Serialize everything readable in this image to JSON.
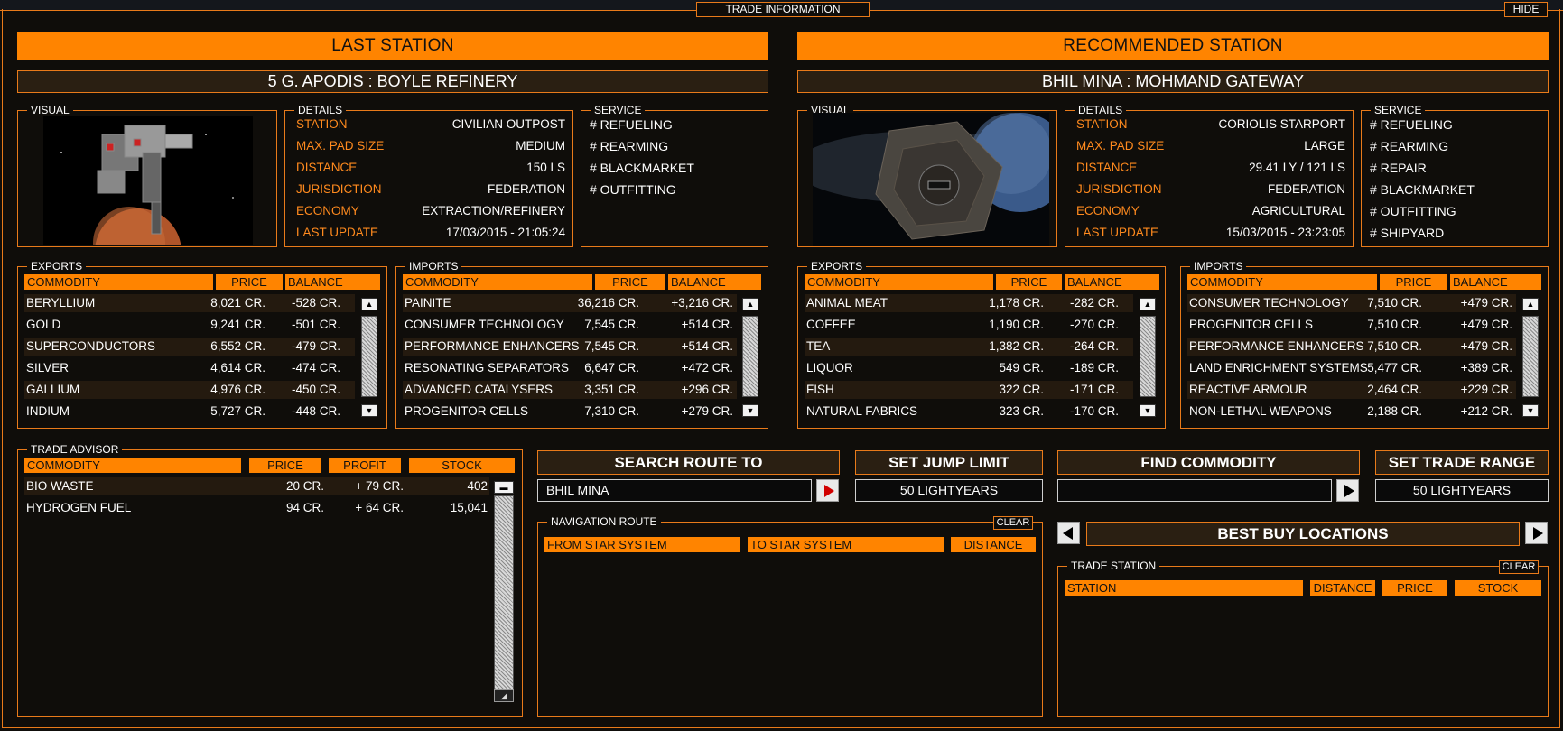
{
  "window": {
    "title": "TRADE INFORMATION",
    "hide": "HIDE"
  },
  "last": {
    "banner": "LAST STATION",
    "name": "5 G. APODIS : BOYLE REFINERY",
    "visual_label": "VISUAL",
    "details_label": "DETAILS",
    "service_label": "SERVICE",
    "details": [
      [
        "STATION",
        "CIVILIAN OUTPOST"
      ],
      [
        "MAX. PAD SIZE",
        "MEDIUM"
      ],
      [
        "DISTANCE",
        "150 LS"
      ],
      [
        "JURISDICTION",
        "FEDERATION"
      ],
      [
        "ECONOMY",
        "EXTRACTION/REFINERY"
      ],
      [
        "LAST UPDATE",
        "17/03/2015 - 21:05:24"
      ]
    ],
    "services": [
      "# REFUELING",
      "# REARMING",
      "# BLACKMARKET",
      "# OUTFITTING"
    ],
    "exports": {
      "label": "EXPORTS",
      "headers": [
        "COMMODITY",
        "PRICE",
        "BALANCE"
      ],
      "rows": [
        [
          "BERYLLIUM",
          "8,021 CR.",
          "-528 CR."
        ],
        [
          "GOLD",
          "9,241 CR.",
          "-501 CR."
        ],
        [
          "SUPERCONDUCTORS",
          "6,552 CR.",
          "-479 CR."
        ],
        [
          "SILVER",
          "4,614 CR.",
          "-474 CR."
        ],
        [
          "GALLIUM",
          "4,976 CR.",
          "-450 CR."
        ],
        [
          "INDIUM",
          "5,727 CR.",
          "-448 CR."
        ]
      ]
    },
    "imports": {
      "label": "IMPORTS",
      "headers": [
        "COMMODITY",
        "PRICE",
        "BALANCE"
      ],
      "rows": [
        [
          "PAINITE",
          "36,216 CR.",
          "+3,216 CR."
        ],
        [
          "CONSUMER TECHNOLOGY",
          "7,545 CR.",
          "+514 CR."
        ],
        [
          "PERFORMANCE ENHANCERS",
          "7,545 CR.",
          "+514 CR."
        ],
        [
          "RESONATING SEPARATORS",
          "6,647 CR.",
          "+472 CR."
        ],
        [
          "ADVANCED CATALYSERS",
          "3,351 CR.",
          "+296 CR."
        ],
        [
          "PROGENITOR CELLS",
          "7,310 CR.",
          "+279 CR."
        ]
      ]
    }
  },
  "recommended": {
    "banner": "RECOMMENDED STATION",
    "name": "BHIL MINA : MOHMAND GATEWAY",
    "visual_label": "VISUAL",
    "details_label": "DETAILS",
    "service_label": "SERVICE",
    "details": [
      [
        "STATION",
        "CORIOLIS STARPORT"
      ],
      [
        "MAX. PAD SIZE",
        "LARGE"
      ],
      [
        "DISTANCE",
        "29.41 LY / 121 LS"
      ],
      [
        "JURISDICTION",
        "FEDERATION"
      ],
      [
        "ECONOMY",
        "AGRICULTURAL"
      ],
      [
        "LAST UPDATE",
        "15/03/2015 - 23:23:05"
      ]
    ],
    "services": [
      "# REFUELING",
      "# REARMING",
      "# REPAIR",
      "# BLACKMARKET",
      "# OUTFITTING",
      "# SHIPYARD"
    ],
    "exports": {
      "label": "EXPORTS",
      "headers": [
        "COMMODITY",
        "PRICE",
        "BALANCE"
      ],
      "rows": [
        [
          "ANIMAL MEAT",
          "1,178 CR.",
          "-282 CR."
        ],
        [
          "COFFEE",
          "1,190 CR.",
          "-270 CR."
        ],
        [
          "TEA",
          "1,382 CR.",
          "-264 CR."
        ],
        [
          "LIQUOR",
          "549 CR.",
          "-189 CR."
        ],
        [
          "FISH",
          "322 CR.",
          "-171 CR."
        ],
        [
          "NATURAL FABRICS",
          "323 CR.",
          "-170 CR."
        ]
      ]
    },
    "imports": {
      "label": "IMPORTS",
      "headers": [
        "COMMODITY",
        "PRICE",
        "BALANCE"
      ],
      "rows": [
        [
          "CONSUMER TECHNOLOGY",
          "7,510 CR.",
          "+479 CR."
        ],
        [
          "PROGENITOR CELLS",
          "7,510 CR.",
          "+479 CR."
        ],
        [
          "PERFORMANCE ENHANCERS",
          "7,510 CR.",
          "+479 CR."
        ],
        [
          "LAND ENRICHMENT SYSTEMS",
          "5,477 CR.",
          "+389 CR."
        ],
        [
          "REACTIVE ARMOUR",
          "2,464 CR.",
          "+229 CR."
        ],
        [
          "NON-LETHAL WEAPONS",
          "2,188 CR.",
          "+212 CR."
        ]
      ]
    }
  },
  "advisor": {
    "label": "TRADE ADVISOR",
    "headers": [
      "COMMODITY",
      "PRICE",
      "PROFIT",
      "STOCK"
    ],
    "rows": [
      [
        "BIO WASTE",
        "20 CR.",
        "+ 79 CR.",
        "402"
      ],
      [
        "HYDROGEN FUEL",
        "94 CR.",
        "+ 64 CR.",
        "15,041"
      ]
    ]
  },
  "search": {
    "title": "SEARCH ROUTE TO",
    "value": "BHIL MINA"
  },
  "jump": {
    "title": "SET JUMP LIMIT",
    "value": "50 LIGHTYEARS"
  },
  "find": {
    "title": "FIND COMMODITY",
    "value": ""
  },
  "range": {
    "title": "SET TRADE RANGE",
    "value": "50 LIGHTYEARS"
  },
  "nav": {
    "label": "NAVIGATION ROUTE",
    "clear": "CLEAR",
    "headers": [
      "FROM STAR SYSTEM",
      "TO STAR SYSTEM",
      "DISTANCE"
    ]
  },
  "best": {
    "title": "BEST BUY LOCATIONS"
  },
  "tradestation": {
    "label": "TRADE STATION",
    "clear": "CLEAR",
    "headers": [
      "STATION",
      "DISTANCE",
      "PRICE",
      "STOCK"
    ]
  },
  "colors": {
    "accent": "#ff8400",
    "label_orange": "#ff8a1e",
    "background": "#0f0d0a"
  }
}
